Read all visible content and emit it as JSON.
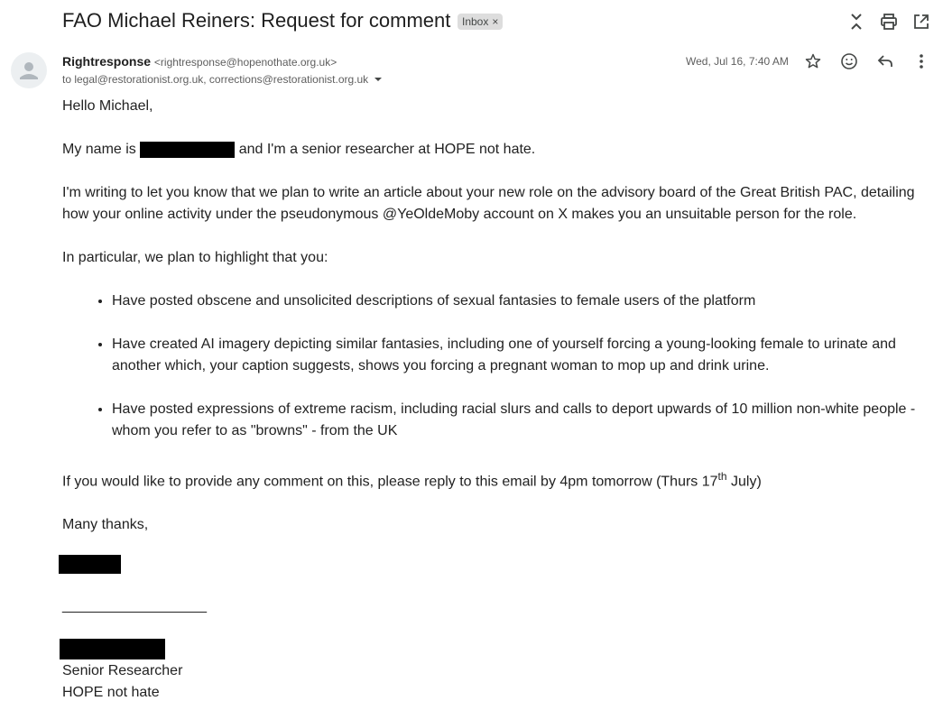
{
  "header": {
    "subject": "FAO Michael Reiners: Request for comment",
    "label": "Inbox",
    "label_close": "×",
    "icons": [
      "collapse-icon",
      "print-icon",
      "open-in-new-window-icon"
    ]
  },
  "message": {
    "sender_name": "Rightresponse",
    "sender_email": "<rightresponse@hopenothate.org.uk>",
    "recipients": "to legal@restorationist.org.uk, corrections@restorationist.org.uk",
    "date": "Wed, Jul 16, 7:40 AM",
    "action_icons": [
      "star-icon",
      "emoji-icon",
      "reply-icon",
      "more-vert-icon"
    ]
  },
  "body": {
    "greeting": "Hello Michael,",
    "intro_pre": "My name is ",
    "intro_post": " and I'm a senior researcher at HOPE not hate.",
    "para1": "I'm writing to let you know that we plan to write an article about your new role on the advisory board of the Great British PAC, detailing how your online activity under the pseudonymous @YeOldeMoby account on X makes you an unsuitable person for the role.",
    "para2": "In particular, we plan to highlight that you:",
    "bullets": [
      "Have posted obscene and unsolicited descriptions of sexual fantasies to female users of the platform",
      "Have created AI imagery depicting similar fantasies, including one of yourself forcing a young-looking female to urinate and another which, your caption suggests, shows you forcing a pregnant woman to mop up and drink urine.",
      "Have posted expressions of extreme racism, including racial slurs and calls to deport upwards of 10 million non-white people - whom you refer to as \"browns\" - from the UK"
    ],
    "comment_pre": "If you would like to provide any comment on this, please reply to this email by 4pm tomorrow (Thurs 17",
    "comment_sup": "th",
    "comment_post": " July)",
    "closing": "Many thanks,",
    "separator": "___________________",
    "sig_title": "Senior Researcher",
    "sig_org": "HOPE not hate"
  }
}
